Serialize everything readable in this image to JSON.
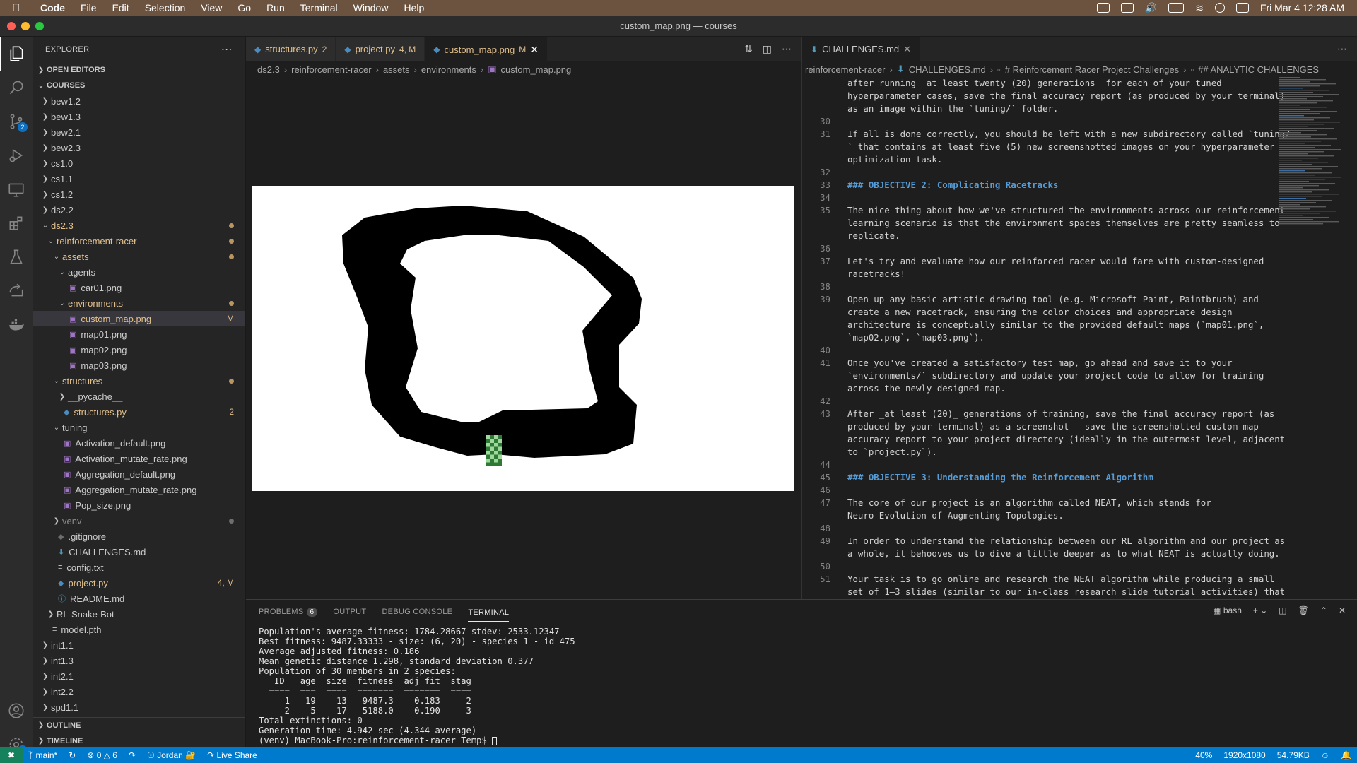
{
  "menubar": {
    "items": [
      "Code",
      "File",
      "Edit",
      "Selection",
      "View",
      "Go",
      "Run",
      "Terminal",
      "Window",
      "Help"
    ],
    "clock": "Fri Mar 4  12:28 AM"
  },
  "window": {
    "title": "custom_map.png — courses"
  },
  "explorer": {
    "header": "EXPLORER",
    "open_editors": "OPEN EDITORS",
    "root": "COURSES",
    "outline": "OUTLINE",
    "timeline": "TIMELINE",
    "tree": [
      {
        "label": "bew1.2",
        "kind": "folder",
        "depth": 0,
        "open": false
      },
      {
        "label": "bew1.3",
        "kind": "folder",
        "depth": 0,
        "open": false
      },
      {
        "label": "bew2.1",
        "kind": "folder",
        "depth": 0,
        "open": false
      },
      {
        "label": "bew2.3",
        "kind": "folder",
        "depth": 0,
        "open": false
      },
      {
        "label": "cs1.0",
        "kind": "folder",
        "depth": 0,
        "open": false
      },
      {
        "label": "cs1.1",
        "kind": "folder",
        "depth": 0,
        "open": false
      },
      {
        "label": "cs1.2",
        "kind": "folder",
        "depth": 0,
        "open": false
      },
      {
        "label": "ds2.2",
        "kind": "folder",
        "depth": 0,
        "open": false
      },
      {
        "label": "ds2.3",
        "kind": "folder",
        "depth": 0,
        "open": true,
        "color": "#e2c08d",
        "dot": true
      },
      {
        "label": "reinforcement-racer",
        "kind": "folder",
        "depth": 1,
        "open": true,
        "color": "#e2c08d",
        "dot": true
      },
      {
        "label": "assets",
        "kind": "folder",
        "depth": 2,
        "open": true,
        "color": "#e2c08d",
        "dot": true
      },
      {
        "label": "agents",
        "kind": "folder",
        "depth": 3,
        "open": true
      },
      {
        "label": "car01.png",
        "kind": "image",
        "depth": 4
      },
      {
        "label": "environments",
        "kind": "folder",
        "depth": 3,
        "open": true,
        "color": "#e2c08d",
        "dot": true
      },
      {
        "label": "custom_map.png",
        "kind": "image",
        "depth": 4,
        "color": "#e2c08d",
        "dec": "M",
        "selected": true
      },
      {
        "label": "map01.png",
        "kind": "image",
        "depth": 4
      },
      {
        "label": "map02.png",
        "kind": "image",
        "depth": 4
      },
      {
        "label": "map03.png",
        "kind": "image",
        "depth": 4
      },
      {
        "label": "structures",
        "kind": "folder",
        "depth": 2,
        "open": true,
        "color": "#e2c08d",
        "dot": true
      },
      {
        "label": "__pycache__",
        "kind": "folder",
        "depth": 3,
        "open": false
      },
      {
        "label": "structures.py",
        "kind": "python",
        "depth": 3,
        "color": "#e2c08d",
        "dec": "2"
      },
      {
        "label": "tuning",
        "kind": "folder",
        "depth": 2,
        "open": true
      },
      {
        "label": "Activation_default.png",
        "kind": "image",
        "depth": 3
      },
      {
        "label": "Activation_mutate_rate.png",
        "kind": "image",
        "depth": 3
      },
      {
        "label": "Aggregation_default.png",
        "kind": "image",
        "depth": 3
      },
      {
        "label": "Aggregation_mutate_rate.png",
        "kind": "image",
        "depth": 3
      },
      {
        "label": "Pop_size.png",
        "kind": "image",
        "depth": 3
      },
      {
        "label": "venv",
        "kind": "folder",
        "depth": 2,
        "open": false,
        "color": "#8c8c8c",
        "dot": true,
        "dotcolor": "#6e6e6e"
      },
      {
        "label": ".gitignore",
        "kind": "git",
        "depth": 2
      },
      {
        "label": "CHALLENGES.md",
        "kind": "md",
        "depth": 2
      },
      {
        "label": "config.txt",
        "kind": "txt",
        "depth": 2
      },
      {
        "label": "project.py",
        "kind": "python",
        "depth": 2,
        "color": "#e2c08d",
        "dec": "4, M"
      },
      {
        "label": "README.md",
        "kind": "info",
        "depth": 2
      },
      {
        "label": "RL-Snake-Bot",
        "kind": "folder",
        "depth": 1,
        "open": false
      },
      {
        "label": "model.pth",
        "kind": "txt",
        "depth": 1
      },
      {
        "label": "int1.1",
        "kind": "folder",
        "depth": 0,
        "open": false
      },
      {
        "label": "int1.3",
        "kind": "folder",
        "depth": 0,
        "open": false
      },
      {
        "label": "int2.1",
        "kind": "folder",
        "depth": 0,
        "open": false
      },
      {
        "label": "int2.2",
        "kind": "folder",
        "depth": 0,
        "open": false
      },
      {
        "label": "spd1.1",
        "kind": "folder",
        "depth": 0,
        "open": false
      }
    ]
  },
  "activity": {
    "scm_badge": "2",
    "settings_badge": "1"
  },
  "editor_left": {
    "tabs": [
      {
        "label": "structures.py",
        "status": "2",
        "color": "#e2c08d",
        "icon": "python"
      },
      {
        "label": "project.py",
        "status": "4, M",
        "color": "#e2c08d",
        "icon": "python"
      },
      {
        "label": "custom_map.png",
        "status": "M",
        "color": "#e2c08d",
        "icon": "image",
        "active": true
      }
    ],
    "breadcrumb": [
      "ds2.3",
      "reinforcement-racer",
      "assets",
      "environments",
      "custom_map.png"
    ]
  },
  "editor_right": {
    "tab": "CHALLENGES.md",
    "breadcrumb": [
      "reinforcement-racer",
      "CHALLENGES.md",
      "# Reinforcement Racer Project Challenges",
      "## ANALYTIC CHALLENGES"
    ],
    "lines": [
      {
        "n": "",
        "t": "after running _at least twenty (20) generations_ for each of your tuned"
      },
      {
        "n": "",
        "t": "hyperparameter cases, save the final accuracy report (as produced by your terminal)"
      },
      {
        "n": "",
        "t": "as an image within the `tuning/` folder."
      },
      {
        "n": "30",
        "t": ""
      },
      {
        "n": "31",
        "t": "If all is done correctly, you should be left with a new subdirectory called `tuning/"
      },
      {
        "n": "",
        "t": "` that contains at least five (5) new screenshotted images on your hyperparameter"
      },
      {
        "n": "",
        "t": "optimization task."
      },
      {
        "n": "32",
        "t": ""
      },
      {
        "n": "33",
        "t": "### OBJECTIVE 2: Complicating Racetracks",
        "h": true
      },
      {
        "n": "34",
        "t": ""
      },
      {
        "n": "35",
        "t": "The nice thing about how we've structured the environments across our reinforcement"
      },
      {
        "n": "",
        "t": "learning scenario is that the environment spaces themselves are pretty seamless to"
      },
      {
        "n": "",
        "t": "replicate."
      },
      {
        "n": "36",
        "t": ""
      },
      {
        "n": "37",
        "t": "Let's try and evaluate how our reinforced racer would fare with custom-designed"
      },
      {
        "n": "",
        "t": "racetracks!"
      },
      {
        "n": "38",
        "t": ""
      },
      {
        "n": "39",
        "t": "Open up any basic artistic drawing tool (e.g. Microsoft Paint, Paintbrush) and"
      },
      {
        "n": "",
        "t": "create a new racetrack, ensuring the color choices and appropriate design"
      },
      {
        "n": "",
        "t": "architecture is conceptually similar to the provided default maps (`map01.png`,"
      },
      {
        "n": "",
        "t": "`map02.png`, `map03.png`)."
      },
      {
        "n": "40",
        "t": ""
      },
      {
        "n": "41",
        "t": "Once you've created a satisfactory test map, go ahead and save it to your"
      },
      {
        "n": "",
        "t": "`environments/` subdirectory and update your project code to allow for training"
      },
      {
        "n": "",
        "t": "across the newly designed map."
      },
      {
        "n": "42",
        "t": ""
      },
      {
        "n": "43",
        "t": "After _at least (20)_ generations of training, save the final accuracy report (as"
      },
      {
        "n": "",
        "t": "produced by your terminal) as a screenshot — save the screenshotted custom map"
      },
      {
        "n": "",
        "t": "accuracy report to your project directory (ideally in the outermost level, adjacent"
      },
      {
        "n": "",
        "t": "to `project.py`)."
      },
      {
        "n": "44",
        "t": ""
      },
      {
        "n": "45",
        "t": "### OBJECTIVE 3: Understanding the Reinforcement Algorithm",
        "h": true
      },
      {
        "n": "46",
        "t": ""
      },
      {
        "n": "47",
        "t": "The core of our project is an algorithm called NEAT, which stands for"
      },
      {
        "n": "",
        "t": "Neuro-Evolution of Augmenting Topologies."
      },
      {
        "n": "48",
        "t": ""
      },
      {
        "n": "49",
        "t": "In order to understand the relationship between our RL algorithm and our project as"
      },
      {
        "n": "",
        "t": "a whole, it behooves us to dive a little deeper as to what NEAT is actually doing."
      },
      {
        "n": "50",
        "t": ""
      },
      {
        "n": "51",
        "t": "Your task is to go online and research the NEAT algorithm while producing a small"
      },
      {
        "n": "",
        "t": "set of 1–3 slides (similar to our in-class research slide tutorial activities) that"
      }
    ]
  },
  "panel": {
    "tabs": [
      "PROBLEMS",
      "OUTPUT",
      "DEBUG CONSOLE",
      "TERMINAL"
    ],
    "problems_count": "6",
    "shell": "bash",
    "terminal_lines": [
      "Population's average fitness: 1784.28667 stdev: 2533.12347",
      "Best fitness: 9487.33333 - size: (6, 20) - species 1 - id 475",
      "Average adjusted fitness: 0.186",
      "Mean genetic distance 1.298, standard deviation 0.377",
      "Population of 30 members in 2 species:",
      "   ID   age  size  fitness  adj fit  stag",
      "  ====  ===  ====  =======  =======  ====",
      "     1   19    13   9487.3    0.183     2",
      "     2    5    17   5188.0    0.190     3",
      "Total extinctions: 0",
      "Generation time: 4.942 sec (4.344 average)",
      "(venv) MacBook-Pro:reinforcement-racer Temp$ "
    ]
  },
  "status": {
    "branch": "main*",
    "errors": "0",
    "warnings": "6",
    "user": "Jordan 🔐",
    "live_share": "Live Share",
    "zoom": "40%",
    "dimensions": "1920x1080",
    "size": "54.79KB"
  },
  "colors": {
    "accent": "#007acc",
    "modified": "#e2c08d",
    "heading": "#569cd6",
    "code_span": "#ce9178"
  }
}
